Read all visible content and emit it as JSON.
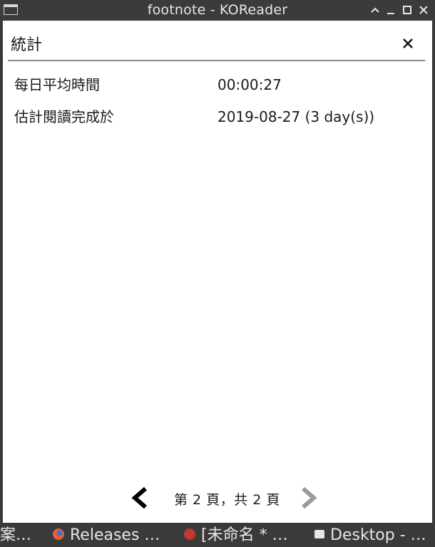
{
  "window": {
    "title": "footnote - KOReader"
  },
  "dialog": {
    "heading": "統計",
    "close_glyph": "×",
    "rows": [
      {
        "label": "每日平均時間",
        "value": "00:00:27"
      },
      {
        "label": "估計閱讀完成於",
        "value": "2019-08-27 (3 day(s))"
      }
    ],
    "pager": {
      "info": "第 2 頁，共 2 頁",
      "prev_enabled": true,
      "next_enabled": false
    }
  },
  "taskbar": {
    "items": [
      {
        "label": "案…",
        "icon": ""
      },
      {
        "label": "Releases …",
        "icon": "firefox-icon"
      },
      {
        "label": "[未命名 * …",
        "icon": "editor-icon"
      },
      {
        "label": "Desktop - …",
        "icon": "window-icon"
      }
    ]
  },
  "colors": {
    "titlebar": "#3b3b3b",
    "content_bg": "#ffffff",
    "rule": "#8a8a8a",
    "next_disabled": "#9a9a9a"
  }
}
